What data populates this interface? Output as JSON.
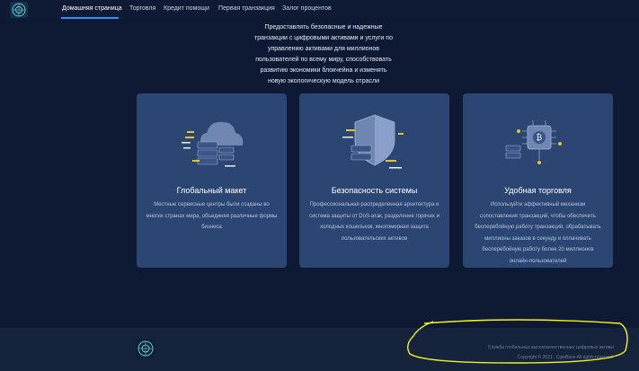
{
  "nav": {
    "items": [
      {
        "label": "Домашняя страница",
        "active": true
      },
      {
        "label": "Торговля",
        "active": false
      },
      {
        "label": "Кредит помощи",
        "active": false
      },
      {
        "label": "Первая транзакция",
        "active": false
      },
      {
        "label": "Залог процентов",
        "active": false
      }
    ]
  },
  "intro": {
    "text": "Предоставлять безопасные и надежные транзакции с цифровыми активами и услуги по управлению активами для миллионов пользователей по всему миру, способствовать развитию экономики блокчейна и изменять новую экологическую модель отрасли"
  },
  "features": [
    {
      "title": "Глобальный макет",
      "description": "Местные сервисные центры были созданы во многих странах мира, объединяя различные формы бизнеса",
      "icon": "server-cloud-icon"
    },
    {
      "title": "Безопасность системы",
      "description": "Профессиональная распределенная архитектура и система защиты от DoS-атак, разделение горячих и холодных кошельков, многомерная защита пользовательских активов",
      "icon": "shield-security-icon"
    },
    {
      "title": "Удобная торговля",
      "description": "Используйте эффективный механизм сопоставления транзакций, чтобы обеспечить бесперебойную работу транзакций, обрабатывать миллионы заказов в секунду и оплачивать бесперебойную работу более 20 миллионов онлайн-пользователей",
      "icon": "bitcoin-chip-icon"
    }
  ],
  "footer": {
    "tagline": "Служба глобальных высококачественных цифровых активы",
    "copyright": "Copyright © 2021 . CipeBase All rights reserved."
  },
  "colors": {
    "background": "#0e1a33",
    "card": "#2b4673",
    "accent": "#3b8dff",
    "highlight": "#f2f21a"
  }
}
